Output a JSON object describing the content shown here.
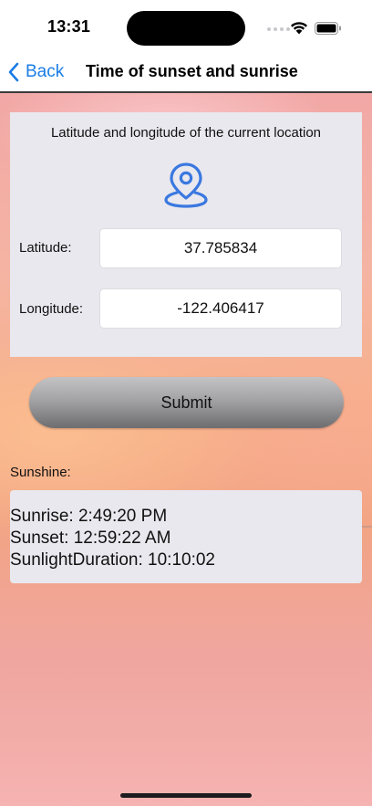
{
  "status_bar": {
    "time": "13:31"
  },
  "nav": {
    "back_label": "Back",
    "title": "Time of sunset and sunrise"
  },
  "location": {
    "heading": "Latitude and longitude of the current location",
    "icon": "location-pin-icon",
    "latitude_label": "Latitude:",
    "latitude_value": "37.785834",
    "longitude_label": "Longitude:",
    "longitude_value": "-122.406417"
  },
  "submit": {
    "label": "Submit"
  },
  "sunshine": {
    "label": "Sunshine:",
    "sunrise": "Sunrise: 2:49:20 PM",
    "sunset": "Sunset: 12:59:22 AM",
    "duration": "SunlightDuration: 10:10:02"
  },
  "colors": {
    "accent": "#1a7de6",
    "icon_blue": "#3a78e0",
    "card_bg": "#e9e8ee"
  }
}
